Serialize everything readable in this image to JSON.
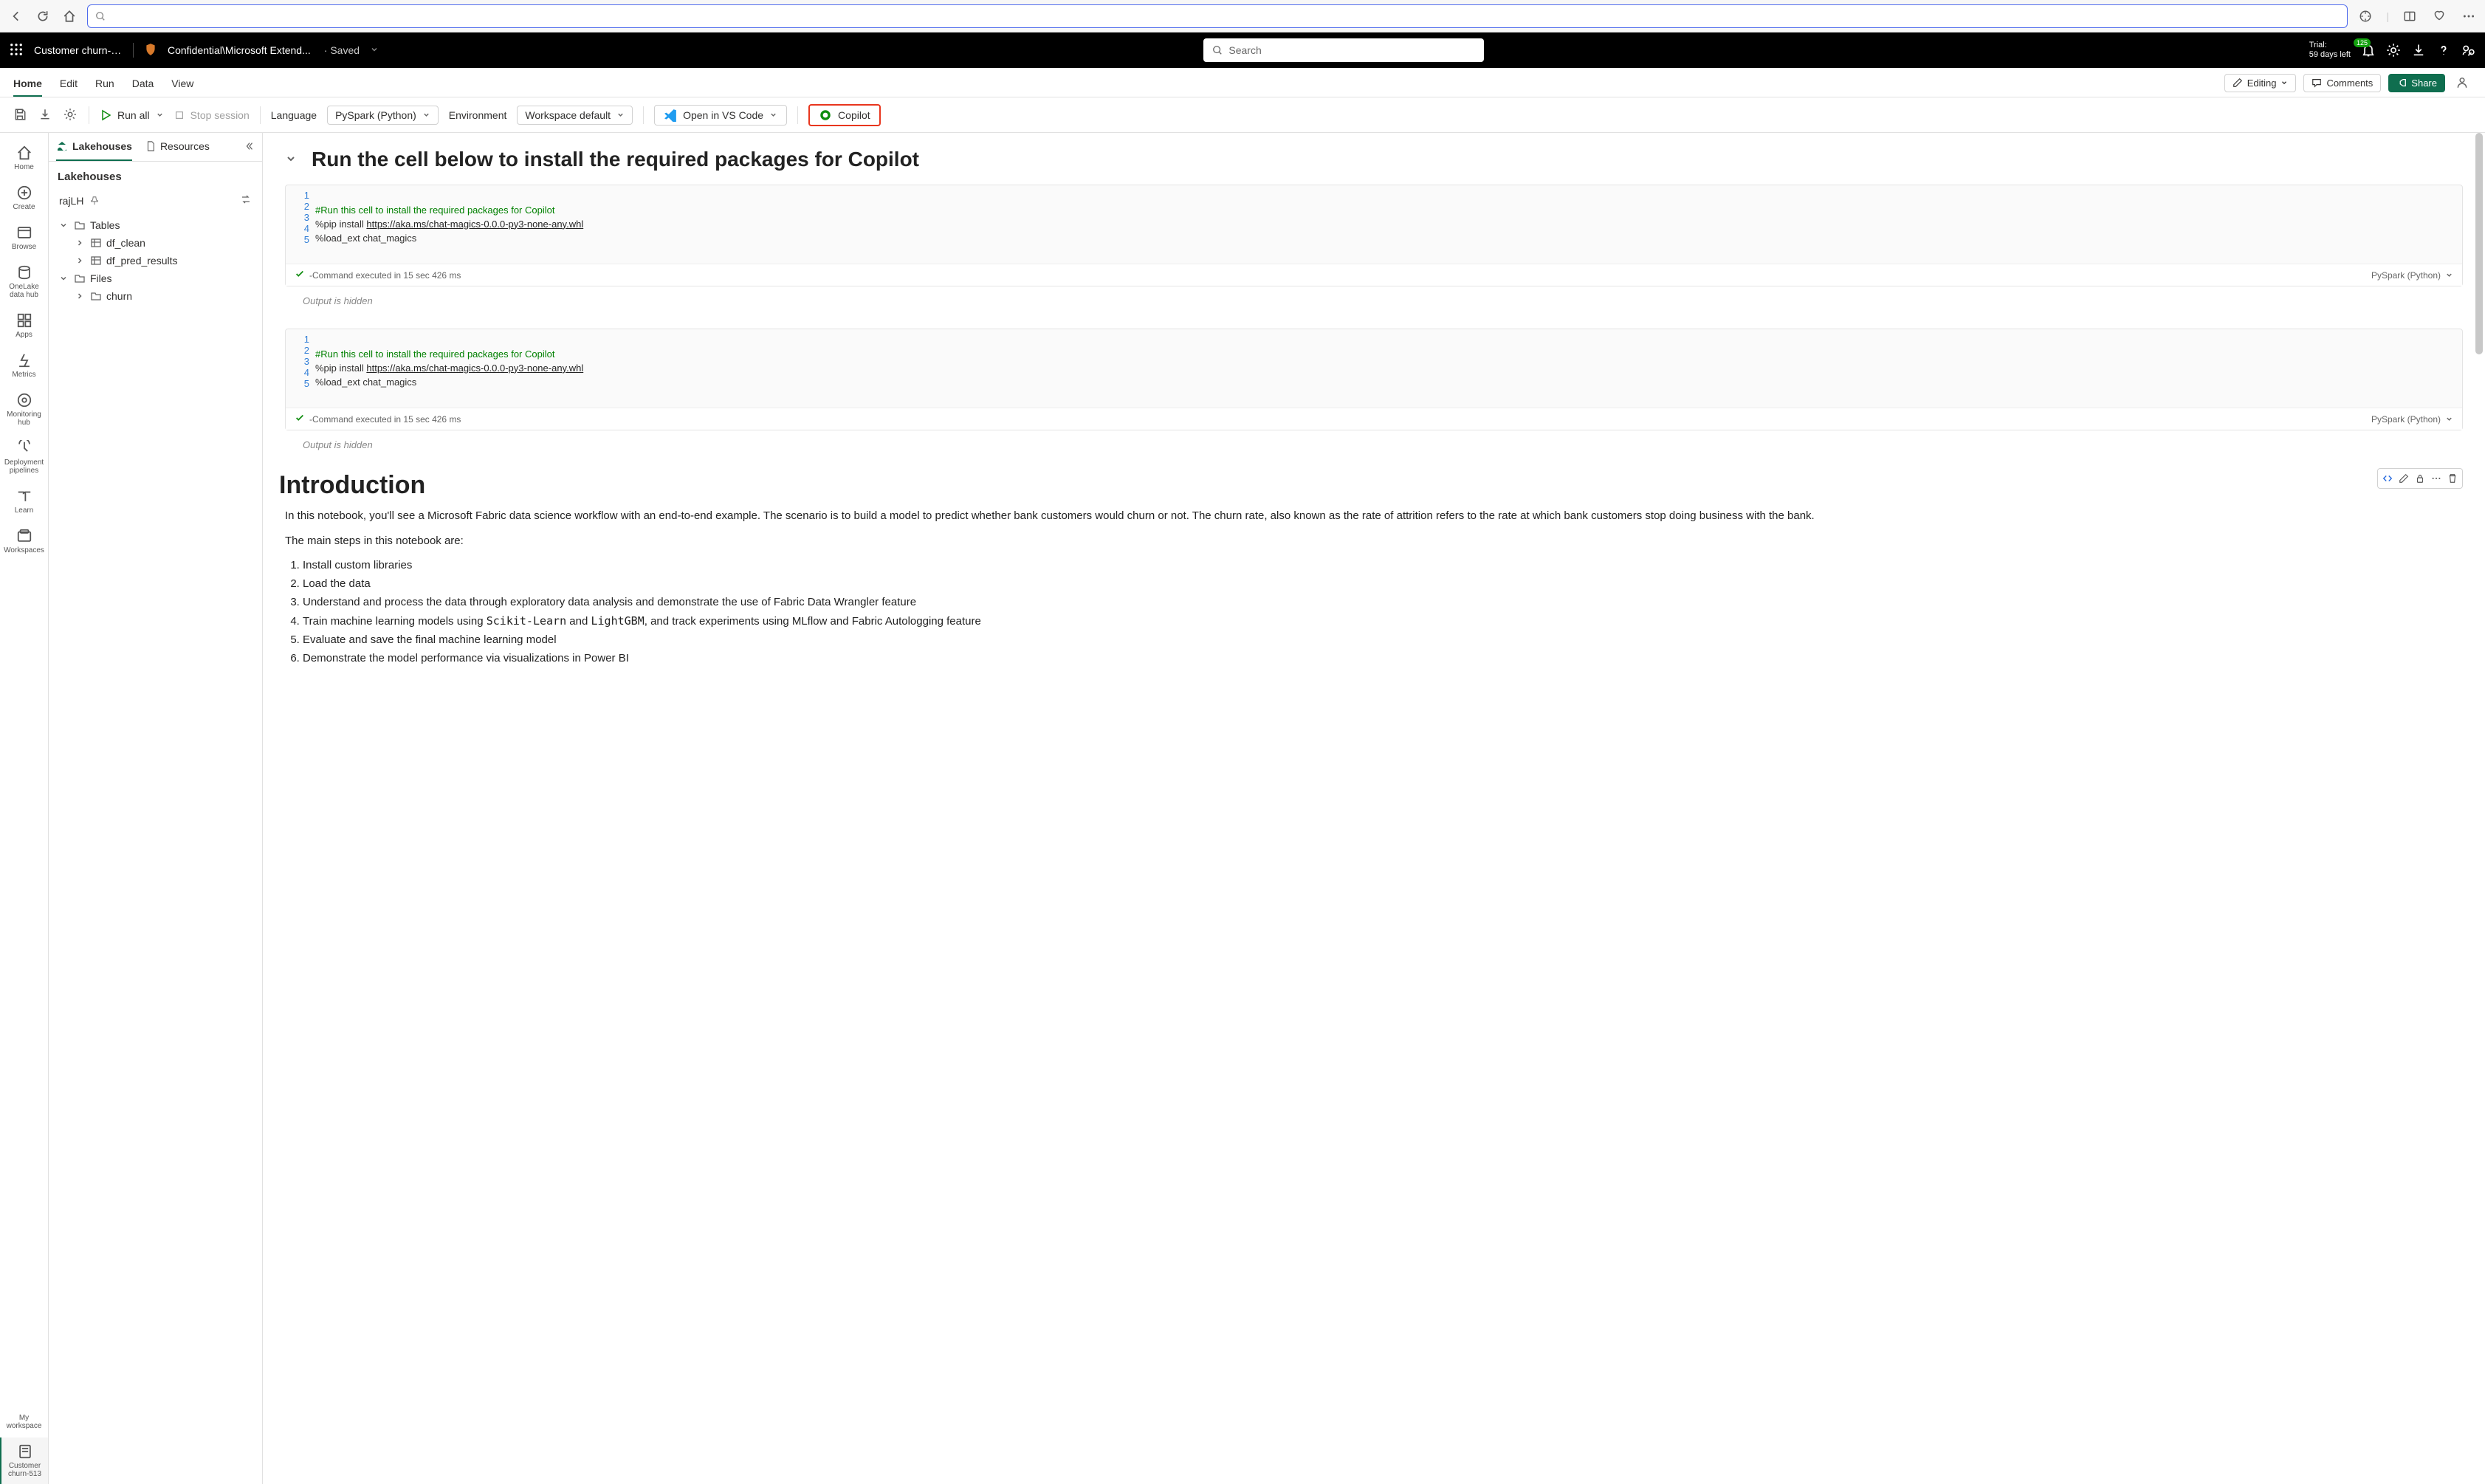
{
  "browser": {
    "search_placeholder": ""
  },
  "header": {
    "doc_title": "Customer churn-5...",
    "sensitivity": "Confidential\\Microsoft Extend...",
    "save_status": "Saved",
    "search_placeholder": "Search",
    "trial_line1": "Trial:",
    "trial_line2": "59 days left",
    "notif_badge": "125"
  },
  "ribbon": {
    "tabs": [
      "Home",
      "Edit",
      "Run",
      "Data",
      "View"
    ],
    "editing": "Editing",
    "comments": "Comments",
    "share": "Share"
  },
  "toolbar": {
    "run_all": "Run all",
    "stop_session": "Stop session",
    "language_label": "Language",
    "language_value": "PySpark (Python)",
    "environment_label": "Environment",
    "environment_value": "Workspace default",
    "open_vs_code": "Open in VS Code",
    "copilot": "Copilot"
  },
  "left_rail": {
    "items": [
      {
        "label": "Home"
      },
      {
        "label": "Create"
      },
      {
        "label": "Browse"
      },
      {
        "label": "OneLake data hub"
      },
      {
        "label": "Apps"
      },
      {
        "label": "Metrics"
      },
      {
        "label": "Monitoring hub"
      },
      {
        "label": "Deployment pipelines"
      },
      {
        "label": "Learn"
      },
      {
        "label": "Workspaces"
      },
      {
        "label": "My workspace"
      },
      {
        "label": "Customer churn-513"
      }
    ]
  },
  "side_panel": {
    "tab1": "Lakehouses",
    "tab2": "Resources",
    "heading": "Lakehouses",
    "lakehouse_name": "rajLH",
    "tables_label": "Tables",
    "table1": "df_clean",
    "table2": "df_pred_results",
    "files_label": "Files",
    "file1": "churn"
  },
  "notebook": {
    "heading1": "Run the cell below to install the required packages for Copilot",
    "cell1": {
      "gutter": [
        "1",
        "2",
        "3",
        "4",
        "5"
      ],
      "line2": "#Run this cell to install the required packages for Copilot",
      "line3_a": "%pip install ",
      "line3_b": "https://aka.ms/chat-magics-0.0.0-py3-none-any.whl",
      "line4": "%load_ext chat_magics",
      "status": "-Command executed in 15 sec 426 ms",
      "kernel": "PySpark (Python)",
      "output": "Output is hidden"
    },
    "cell2": {
      "gutter": [
        "1",
        "2",
        "3",
        "4",
        "5"
      ],
      "line2": "#Run this cell to install the required packages for Copilot",
      "line3_a": "%pip install ",
      "line3_b": "https://aka.ms/chat-magics-0.0.0-py3-none-any.whl",
      "line4": "%load_ext chat_magics",
      "status": "-Command executed in 15 sec 426 ms",
      "kernel": "PySpark (Python)",
      "output": "Output is hidden"
    },
    "md": {
      "title": "Introduction",
      "p1": "In this notebook, you'll see a Microsoft Fabric data science workflow with an end-to-end example. The scenario is to build a model to predict whether bank customers would churn or not. The churn rate, also known as the rate of attrition refers to the rate at which bank customers stop doing business with the bank.",
      "p2": "The main steps in this notebook are:",
      "steps": [
        "Install custom libraries",
        "Load the data",
        "Understand and process the data through exploratory data analysis and demonstrate the use of Fabric Data Wrangler feature",
        "Train machine learning models using Scikit-Learn and LightGBM, and track experiments using MLflow and Fabric Autologging feature",
        "Evaluate and save the final machine learning model",
        "Demonstrate the model performance via visualizations in Power BI"
      ],
      "step4_prefix": "Train machine learning models using ",
      "step4_m1": "Scikit-Learn",
      "step4_mid": " and ",
      "step4_m2": "LightGBM",
      "step4_suffix": ", and track experiments using MLflow and Fabric Autologging feature"
    }
  }
}
